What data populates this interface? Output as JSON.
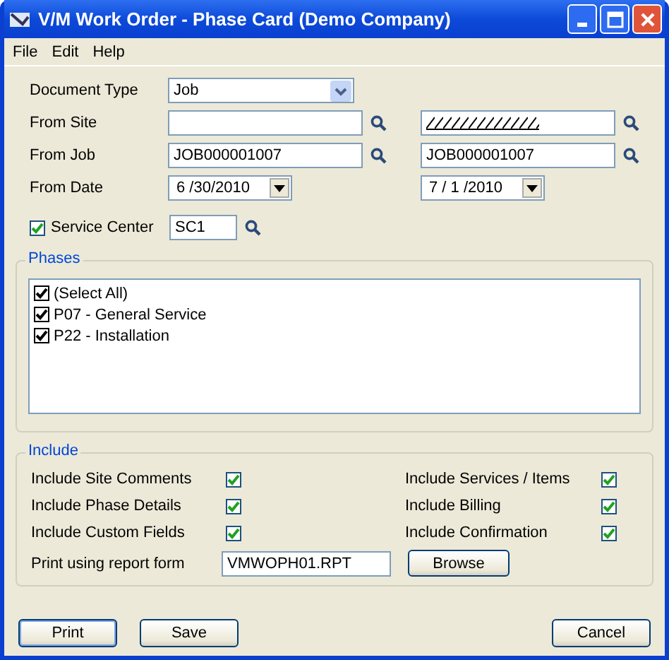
{
  "window": {
    "title": "V/M Work Order - Phase Card (Demo Company)"
  },
  "menu": [
    "File",
    "Edit",
    "Help"
  ],
  "form": {
    "document_type": {
      "label": "Document Type",
      "value": "Job"
    },
    "ranges": [
      {
        "label": "From Site",
        "kind": "lookup",
        "to_hatched": true
      },
      {
        "label": "From Job",
        "kind": "lookup",
        "from": "JOB000001007",
        "to": "JOB000001007",
        "to_hatched": false
      },
      {
        "label": "From Date",
        "kind": "date",
        "from": "6 /30/2010",
        "to": "7 / 1 /2010"
      }
    ],
    "service_center": {
      "label": "Service Center",
      "checked": true,
      "value": "SC1"
    }
  },
  "phases": {
    "title": "Phases",
    "items": [
      {
        "label": "(Select All)",
        "checked": true
      },
      {
        "label": "P07 - General Service",
        "checked": true
      },
      {
        "label": "P22 - Installation",
        "checked": true
      }
    ]
  },
  "include": {
    "title": "Include",
    "options": [
      {
        "label": "Include Site Comments",
        "checked": true
      },
      {
        "label": "Include Services / Items",
        "checked": true
      },
      {
        "label": "Include Phase Details",
        "checked": true
      },
      {
        "label": "Include Billing",
        "checked": true
      },
      {
        "label": "Include Custom Fields",
        "checked": true
      },
      {
        "label": "Include Confirmation",
        "checked": true
      }
    ],
    "report": {
      "label": "Print using report form",
      "value": "VMWOPH01.RPT",
      "button": "Browse"
    }
  },
  "buttons": {
    "print": "Print",
    "save": "Save",
    "cancel": "Cancel"
  }
}
